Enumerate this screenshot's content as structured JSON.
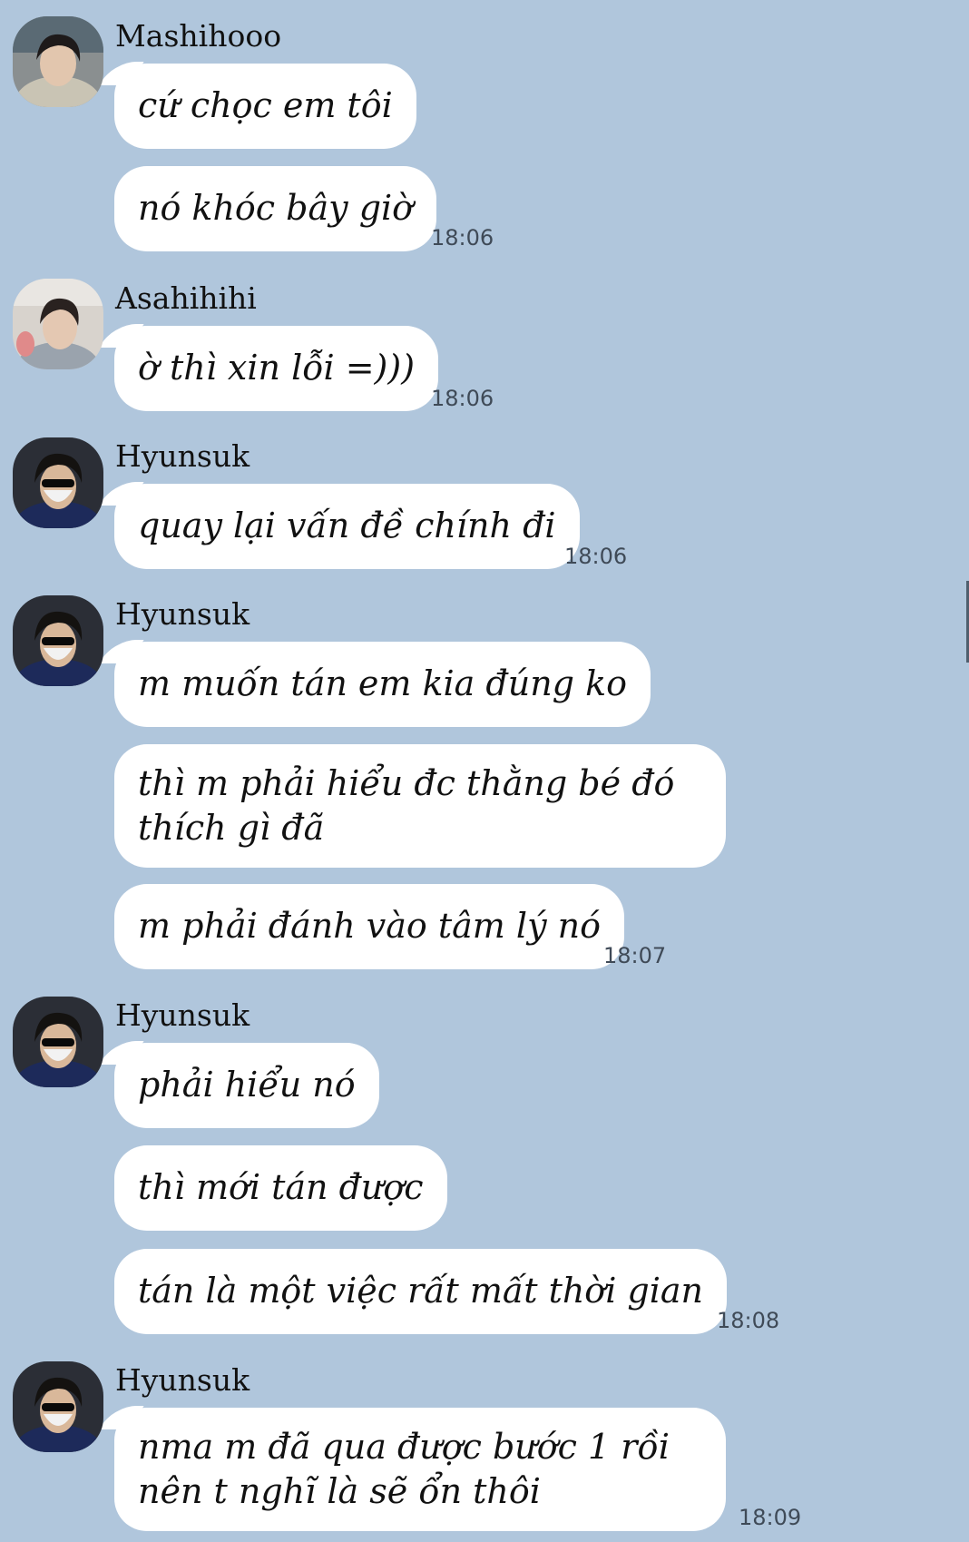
{
  "chat": {
    "messages": [
      {
        "sender": "Mashihooo",
        "avatar": "avatar-mashihooo",
        "bubbles": [
          "cứ chọc em tôi",
          "nó khóc bây giờ"
        ],
        "time": "18:06"
      },
      {
        "sender": "Asahihihi",
        "avatar": "avatar-asahihihi",
        "bubbles": [
          "ờ thì xin lỗi =)))"
        ],
        "time": "18:06"
      },
      {
        "sender": "Hyunsuk",
        "avatar": "avatar-hyunsuk",
        "bubbles": [
          "quay lại vấn đề chính đi"
        ],
        "time": "18:06"
      },
      {
        "sender": "Hyunsuk",
        "avatar": "avatar-hyunsuk",
        "bubbles": [
          "m muốn tán em kia đúng ko",
          "thì m phải hiểu đc thằng bé đó thích gì đã",
          "m phải đánh vào tâm lý nó"
        ],
        "time": "18:07"
      },
      {
        "sender": "Hyunsuk",
        "avatar": "avatar-hyunsuk",
        "bubbles": [
          "phải hiểu nó",
          "thì mới tán được",
          "tán là một việc rất mất thời gian"
        ],
        "time": "18:08"
      },
      {
        "sender": "Hyunsuk",
        "avatar": "avatar-hyunsuk",
        "bubbles": [
          "nma m đã qua được bước 1 rồi nên t nghĩ là sẽ ổn thôi"
        ],
        "time": "18:09"
      }
    ]
  },
  "colors": {
    "background": "#b0c6dc",
    "bubble": "#ffffff",
    "timestamp": "#3f4a57"
  }
}
